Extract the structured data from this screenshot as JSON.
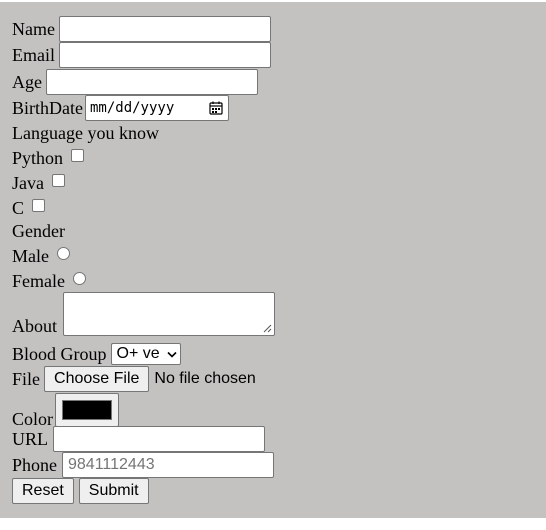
{
  "form": {
    "name_label": "Name",
    "email_label": "Email",
    "age_label": "Age",
    "birthdate_label": "BirthDate",
    "birthdate_placeholder": "mm/dd/yyyy",
    "language_heading": "Language you know",
    "languages": [
      "Python",
      "Java",
      "C"
    ],
    "gender_heading": "Gender",
    "genders": [
      "Male",
      "Female"
    ],
    "about_label": "About",
    "blood_group_label": "Blood Group",
    "blood_group_selected": "O+ ve",
    "file_label": "File",
    "file_button": "Choose File",
    "file_status": "No file chosen",
    "color_label": "Color",
    "color_value": "#000000",
    "url_label": "URL",
    "phone_label": "Phone",
    "phone_placeholder": "9841112443",
    "reset_label": "Reset",
    "submit_label": "Submit"
  },
  "colors": {
    "panel_background": "#c4c2c0",
    "field_background": "#ffffff",
    "button_background": "#efefef",
    "border": "#767676"
  }
}
